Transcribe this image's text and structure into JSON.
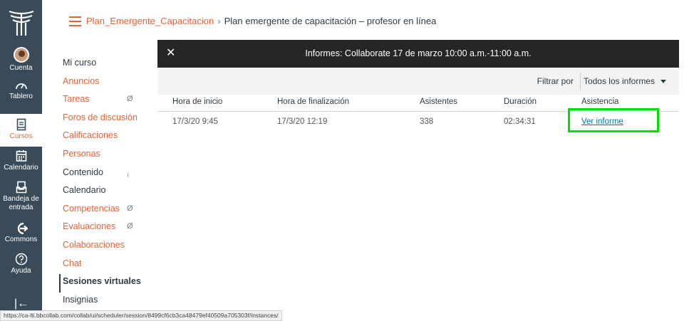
{
  "global_nav": {
    "items": [
      {
        "label": "Cuenta",
        "icon": "avatar"
      },
      {
        "label": "Tablero",
        "icon": "dashboard-icon"
      },
      {
        "label": "Cursos",
        "icon": "courses-icon"
      },
      {
        "label": "Calendario",
        "icon": "calendar-icon"
      },
      {
        "label": "Bandeja de entrada",
        "icon": "inbox-icon"
      },
      {
        "label": "Commons",
        "icon": "commons-icon"
      },
      {
        "label": "Ayuda",
        "icon": "help-icon"
      }
    ],
    "active": "Cursos",
    "accent": "#e66135",
    "background": "#394b58"
  },
  "breadcrumb": {
    "course": "Plan_Emergente_Capacitacion",
    "separator": "›",
    "current": "Plan emergente de capacitación – profesor en línea"
  },
  "course_nav": {
    "items": [
      {
        "label": "Mi curso",
        "style": "plain"
      },
      {
        "label": "Anuncios",
        "style": "link"
      },
      {
        "label": "Tareas",
        "style": "link",
        "hidden": true
      },
      {
        "label": "Foros de discusión",
        "style": "link"
      },
      {
        "label": "Calificaciones",
        "style": "link"
      },
      {
        "label": "Personas",
        "style": "link"
      },
      {
        "label": "Contenido",
        "style": "plain"
      },
      {
        "label": "Calendario",
        "style": "plain"
      },
      {
        "label": "Competencias",
        "style": "link",
        "hidden": true
      },
      {
        "label": "Evaluaciones",
        "style": "link",
        "hidden": true
      },
      {
        "label": "Colaboraciones",
        "style": "link"
      },
      {
        "label": "Chat",
        "style": "link"
      },
      {
        "label": "Sesiones virtuales",
        "style": "active"
      },
      {
        "label": "Insignias",
        "style": "plain"
      }
    ]
  },
  "panel": {
    "close_icon": "close-icon",
    "title": "Informes: Collaborate 17 de marzo 10:00 a.m.-11:00 a.m.",
    "filter_label": "Filtrar por",
    "filter_value": "Todos los informes"
  },
  "table": {
    "headers": [
      "Hora de inicio",
      "Hora de finalización",
      "Asistentes",
      "Duración",
      "Asistencia"
    ],
    "rows": [
      [
        "17/3/20 9:45",
        "17/3/20 12:19",
        "338",
        "02:34:31",
        "Ver informe"
      ]
    ],
    "highlight_color": "#00e000"
  },
  "status_bar": {
    "url": "https://ca-lti.bbcollab.com/collab/ui/scheduler/session/8499cf6cb3ca48479ef40509a705303f/instances/"
  }
}
